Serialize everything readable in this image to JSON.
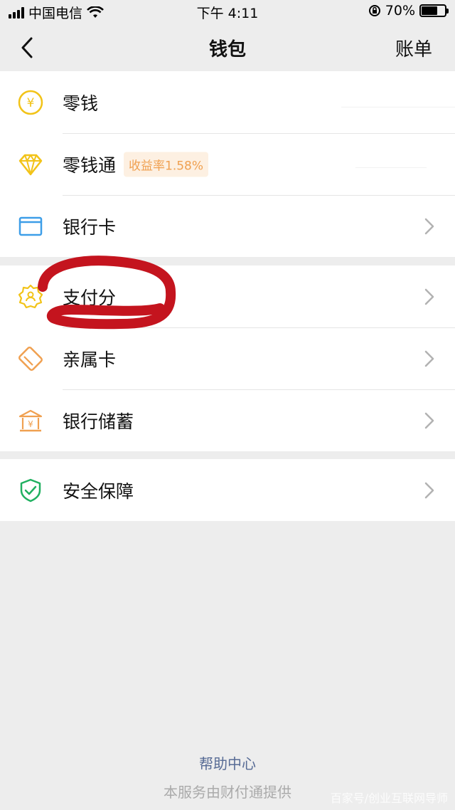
{
  "status_bar": {
    "carrier": "中国电信",
    "time": "下午 4:11",
    "battery": "70%",
    "battery_level": 0.7
  },
  "nav": {
    "title": "钱包",
    "right_action": "账单"
  },
  "groups": [
    {
      "items": [
        {
          "label": "零钱",
          "icon": "yuan-coin-icon"
        },
        {
          "label": "零钱通",
          "icon": "diamond-icon",
          "badge": "收益率1.58%"
        },
        {
          "label": "银行卡",
          "icon": "bank-card-icon"
        }
      ]
    },
    {
      "items": [
        {
          "label": "支付分",
          "icon": "pay-score-badge-icon"
        },
        {
          "label": "亲属卡",
          "icon": "family-card-icon"
        },
        {
          "label": "银行储蓄",
          "icon": "bank-savings-icon"
        }
      ]
    },
    {
      "items": [
        {
          "label": "安全保障",
          "icon": "security-shield-icon"
        }
      ]
    }
  ],
  "footer": {
    "help": "帮助中心",
    "provider": "本服务由财付通提供"
  },
  "watermark": "百家号/创业互联网导师",
  "colors": {
    "accent_yellow": "#f2c318",
    "accent_orange": "#f0a050",
    "accent_blue": "#3d9ee8",
    "accent_green": "#20b060",
    "link_blue": "#576b95",
    "annotation_red": "#c4141e"
  }
}
